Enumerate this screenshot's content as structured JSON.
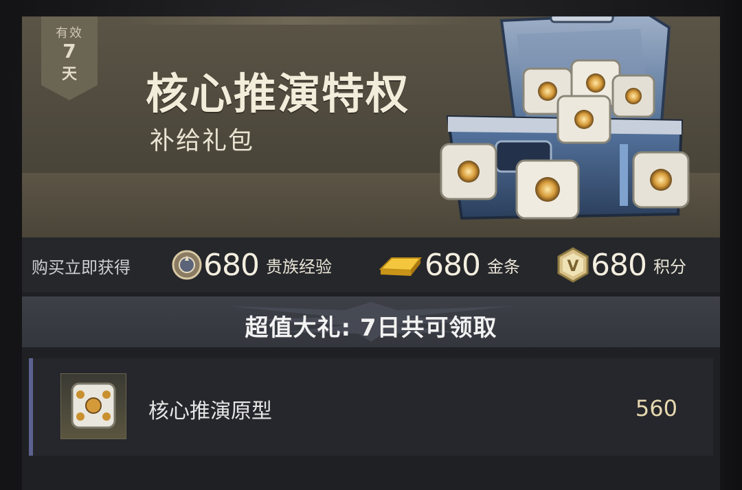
{
  "badge": {
    "top": "有效",
    "num": "7",
    "unit": "天"
  },
  "banner": {
    "title": "核心推演特权",
    "subtitle": "补给礼包"
  },
  "rewards": {
    "label": "购买立即获得",
    "items": [
      {
        "icon": "noble-emblem-icon",
        "value": "680",
        "name": "贵族经验"
      },
      {
        "icon": "gold-bar-icon",
        "value": "680",
        "name": "金条"
      },
      {
        "icon": "v-points-icon",
        "value": "680",
        "name": "积分"
      }
    ]
  },
  "strip": {
    "text": "超值大礼: 7日共可领取"
  },
  "item": {
    "icon": "core-cube-icon",
    "name": "核心推演原型",
    "count": "560"
  },
  "colors": {
    "accent_border": "#5c6290",
    "gold": "#e7d9b0",
    "banner": "#524c3f"
  }
}
